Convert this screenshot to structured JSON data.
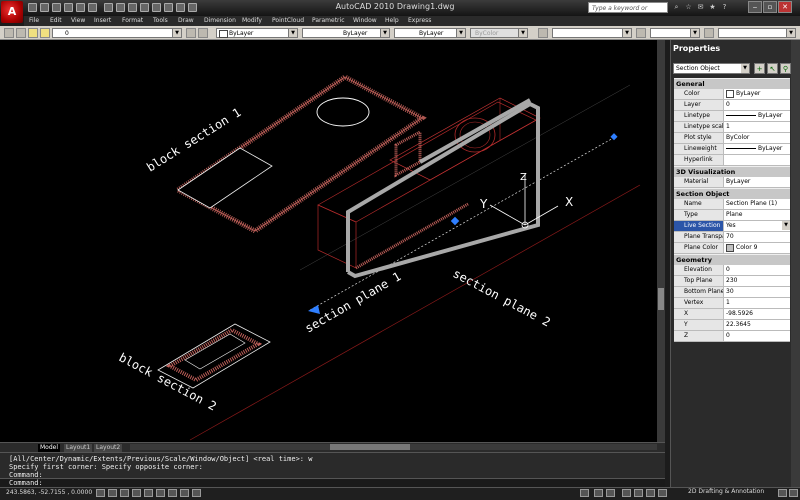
{
  "app": {
    "title": "AutoCAD 2010    Drawing1.dwg",
    "logo_letter": "A",
    "search_placeholder": "Type a keyword or phrase"
  },
  "menus": [
    "File",
    "Edit",
    "View",
    "Insert",
    "Format",
    "Tools",
    "Draw",
    "Dimension",
    "Modify",
    "PointCloud",
    "Parametric",
    "Window",
    "Help",
    "Express"
  ],
  "toolbar": {
    "layer_value": "0",
    "color_value": "ByLayer",
    "linetype_value": "ByLayer",
    "lineweight_value": "ByLayer",
    "plotstyle_value": "ByColor"
  },
  "drawing": {
    "labels": {
      "block_section_1": "block section 1",
      "block_section_2": "block section 2",
      "section_plane_1": "section plane 1",
      "section_plane_2": "section plane 2",
      "axis_x": "X",
      "axis_y": "Y",
      "axis_z": "Z"
    },
    "colors": {
      "background": "#000000",
      "hatch": "#c0605a",
      "object": "#b02a2a",
      "section_plane": "#a8a8a8",
      "grip": "#2f7fff",
      "lines": "#ffffff"
    }
  },
  "layout_tabs": [
    "Model",
    "Layout1",
    "Layout2"
  ],
  "command": {
    "history": [
      "[All/Center/Dynamic/Extents/Previous/Scale/Window/Object] <real time>: w",
      "Specify first corner: Specify opposite corner:",
      "Command:"
    ],
    "prompt": "Command:"
  },
  "status": {
    "coordinates": "243.5863, -52.7155 , 0.0000",
    "workspace": "2D Drafting & Annotation"
  },
  "properties": {
    "title": "Properties",
    "selection": "Section Object",
    "sections": [
      {
        "name": "General",
        "rows": [
          {
            "key": "Color",
            "value": "ByLayer",
            "swatch": "#ffffff"
          },
          {
            "key": "Layer",
            "value": "0"
          },
          {
            "key": "Linetype",
            "value": "ByLayer",
            "line": true
          },
          {
            "key": "Linetype scale",
            "value": "1"
          },
          {
            "key": "Plot style",
            "value": "ByColor"
          },
          {
            "key": "Lineweight",
            "value": "ByLayer",
            "line": true
          },
          {
            "key": "Hyperlink",
            "value": ""
          }
        ]
      },
      {
        "name": "3D Visualization",
        "rows": [
          {
            "key": "Material",
            "value": "ByLayer"
          }
        ]
      },
      {
        "name": "Section Object",
        "rows": [
          {
            "key": "Name",
            "value": "Section Plane (1)"
          },
          {
            "key": "Type",
            "value": "Plane"
          },
          {
            "key": "Live Section",
            "value": "Yes",
            "dropdown": true,
            "highlight": true
          },
          {
            "key": "Plane Transpar...",
            "value": "70"
          },
          {
            "key": "Plane Color",
            "value": "Color 9",
            "swatch": "#c0c0c0"
          }
        ]
      },
      {
        "name": "Geometry",
        "rows": [
          {
            "key": "Elevation",
            "value": "0"
          },
          {
            "key": "Top Plane",
            "value": "230"
          },
          {
            "key": "Bottom Plane",
            "value": "30"
          },
          {
            "key": "Vertex",
            "value": "1"
          },
          {
            "key": "X",
            "value": "-98.5926"
          },
          {
            "key": "Y",
            "value": "22.3645"
          },
          {
            "key": "Z",
            "value": "0"
          }
        ]
      }
    ]
  }
}
